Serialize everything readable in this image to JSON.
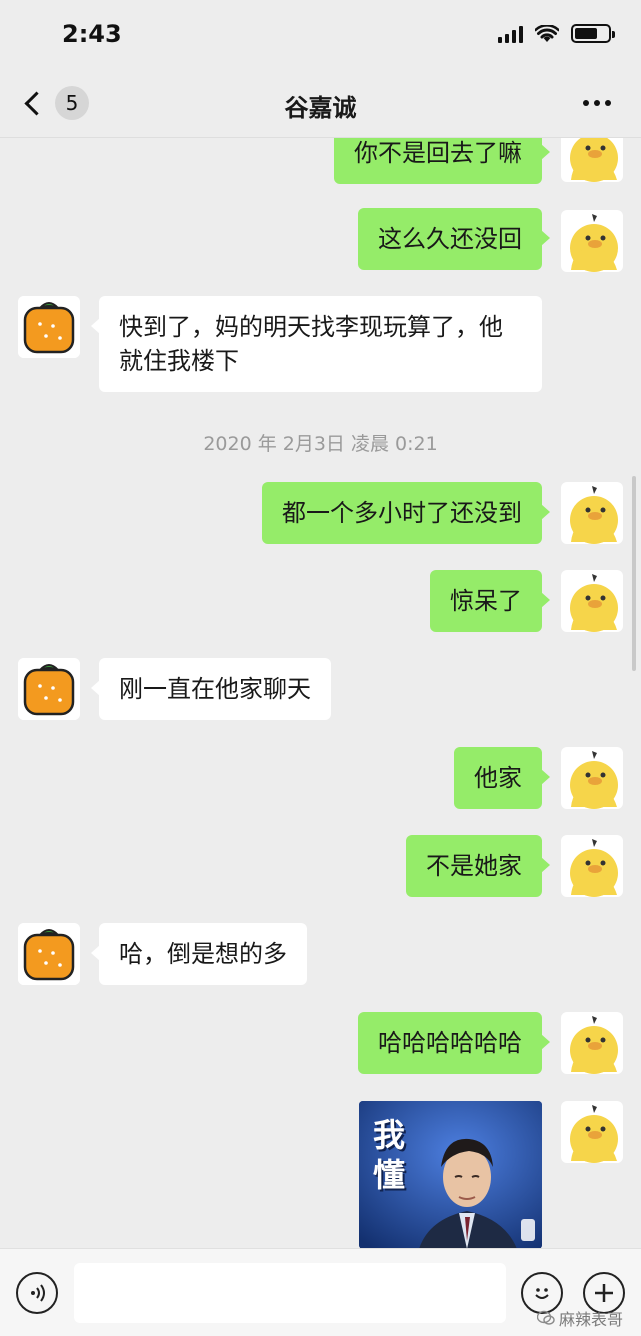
{
  "status_bar": {
    "time": "2:43",
    "battery_level": 0.7
  },
  "nav": {
    "back_count": "5",
    "title": "谷嘉诚",
    "more_icon": "ellipsis-icon"
  },
  "messages": [
    {
      "from": "me",
      "text": "你不是回去了嘛"
    },
    {
      "from": "me",
      "text": "这么久还没回"
    },
    {
      "from": "them",
      "text": "快到了，妈的明天找李现玩算了，他就住我楼下"
    },
    {
      "timestamp": "2020 年 2月3日 凌晨 0:21"
    },
    {
      "from": "me",
      "text": "都一个多小时了还没到"
    },
    {
      "from": "me",
      "text": "惊呆了"
    },
    {
      "from": "them",
      "text": "刚一直在他家聊天"
    },
    {
      "from": "me",
      "text": "他家"
    },
    {
      "from": "me",
      "text": "不是她家"
    },
    {
      "from": "them",
      "text": "哈，倒是想的多"
    },
    {
      "from": "me",
      "text": "哈哈哈哈哈哈"
    },
    {
      "from": "me",
      "sticker_text": "我懂"
    }
  ],
  "input": {
    "placeholder": ""
  },
  "watermark": "麻辣表哥",
  "colors": {
    "my_bubble": "#95ec69",
    "their_bubble": "#ffffff",
    "background": "#ededed"
  }
}
